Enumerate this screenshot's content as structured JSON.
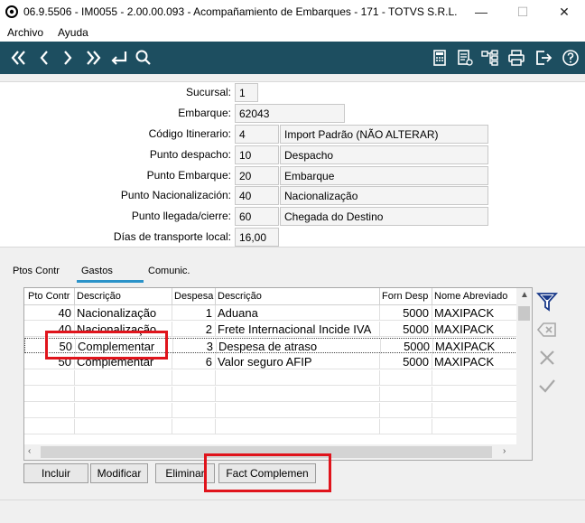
{
  "window": {
    "title": "06.9.5506 - IM0055 - 2.00.00.093 - Acompañamiento de Embarques - 171 - TOTVS S.R.L.",
    "minimize": "—",
    "maximize": "☐",
    "close": "✕"
  },
  "menu": [
    "Archivo",
    "Ayuda"
  ],
  "toolbar": {
    "left_icons": [
      "first-record-icon",
      "previous-record-icon",
      "next-record-icon",
      "last-record-icon",
      "goto-return-icon",
      "search-icon"
    ],
    "right_icons": [
      "calculator-icon",
      "document-edit-icon",
      "tree-icon",
      "print-icon",
      "exit-icon",
      "help-icon"
    ]
  },
  "form": {
    "sucursal": {
      "label": "Sucursal:",
      "value": "1"
    },
    "embarque": {
      "label": "Embarque:",
      "value": "62043"
    },
    "itinerario": {
      "label": "Código Itinerario:",
      "code": "4",
      "desc": "Import Padrão (NÃO ALTERAR)"
    },
    "despacho": {
      "label": "Punto despacho:",
      "code": "10",
      "desc": "Despacho"
    },
    "punto_embarque": {
      "label": "Punto Embarque:",
      "code": "20",
      "desc": "Embarque"
    },
    "nacionalizacion": {
      "label": "Punto Nacionalización:",
      "code": "40",
      "desc": "Nacionalização"
    },
    "llegada": {
      "label": "Punto llegada/cierre:",
      "code": "60",
      "desc": "Chegada do Destino"
    },
    "dias": {
      "label": "Días de transporte local:",
      "value": "16,00"
    }
  },
  "tabs": [
    "Ptos Contr",
    "Gastos",
    "Comunic."
  ],
  "active_tab": "Gastos",
  "grid": {
    "columns": [
      "Pto Contr",
      "Descrição",
      "Despesa",
      "Descrição",
      "Forn Desp",
      "Nome Abreviado"
    ],
    "rows": [
      [
        "40",
        "Nacionalização",
        "1",
        "Aduana",
        "5000",
        "MAXIPACK"
      ],
      [
        "40",
        "Nacionalização",
        "2",
        "Frete Internacional Incide IVA",
        "5000",
        "MAXIPACK"
      ],
      [
        "50",
        "Complementar",
        "3",
        "Despesa de atraso",
        "5000",
        "MAXIPACK"
      ],
      [
        "50",
        "Complementar",
        "6",
        "Valor seguro AFIP",
        "5000",
        "MAXIPACK"
      ]
    ],
    "selected_row": 2
  },
  "buttons": {
    "incluir": "Incluir",
    "modificar": "Modificar",
    "eliminar": "Eliminar",
    "fact": "Fact Complemen"
  },
  "colors": {
    "toolbar": "#1d4e60",
    "tab_accent": "#2b93c9",
    "highlight": "#e0141c"
  }
}
